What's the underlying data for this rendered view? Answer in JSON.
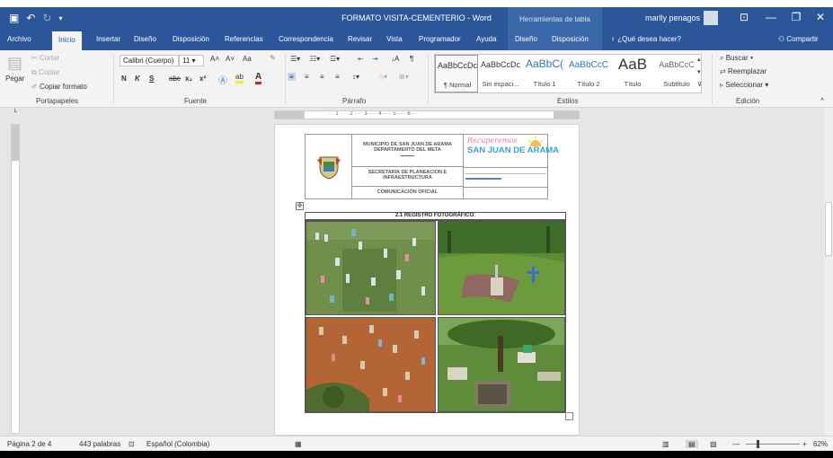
{
  "window": {
    "title": "FORMATO VISITA-CEMENTERIO  -  Word",
    "contextual_tab_title": "Herramientas de tabla",
    "user_name": "marlly penagos",
    "accent_color": "#2b579a"
  },
  "tabs": [
    {
      "label": "Archivo"
    },
    {
      "label": "Inicio",
      "active": true
    },
    {
      "label": "Insertar"
    },
    {
      "label": "Diseño"
    },
    {
      "label": "Disposición"
    },
    {
      "label": "Referencias"
    },
    {
      "label": "Correspondencia"
    },
    {
      "label": "Revisar"
    },
    {
      "label": "Vista"
    },
    {
      "label": "Programador"
    },
    {
      "label": "Ayuda"
    },
    {
      "label": "Diseño"
    },
    {
      "label": "Disposición"
    }
  ],
  "tell_me": "¿Qué desea hacer?",
  "share": "Compartir",
  "clipboard": {
    "paste": "Pegar",
    "cut": "Cortar",
    "copy": "Copiar",
    "format_painter": "Copiar formato",
    "group_label": "Portapapeles"
  },
  "font": {
    "name": "Calibri (Cuerpo)",
    "size": "11",
    "group_label": "Fuente",
    "bold": "N",
    "italic": "K",
    "underline": "S",
    "strike": "abc",
    "subscript": "x₂",
    "superscript": "x²",
    "grow": "A˄",
    "shrink": "A˅",
    "case": "Aa"
  },
  "paragraph": {
    "group_label": "Párrafo"
  },
  "styles": {
    "group_label": "Estilos",
    "items": [
      {
        "preview": "AaBbCcDc",
        "name": "¶ Normal"
      },
      {
        "preview": "AaBbCcDc",
        "name": "Sin espaci..."
      },
      {
        "preview": "AaBbC(",
        "name": "Título 1"
      },
      {
        "preview": "AaBbCcC",
        "name": "Título 2"
      },
      {
        "preview": "AaB",
        "name": "Título"
      },
      {
        "preview": "AaBbCcC",
        "name": "Subtítulo"
      }
    ]
  },
  "editing": {
    "group_label": "Edición",
    "find": "Buscar",
    "replace": "Reemplazar",
    "select": "Seleccionar"
  },
  "document": {
    "header_left_lines": [
      "MUNICIPIO DE SAN JUAN DE ARAMA",
      "DEPARTAMENTO DEL META"
    ],
    "header_secretaria": "SECRETARIA DE PLANEACION E INFRAESTRUCTURA",
    "header_comunicacion": "COMUNICACIÓN OFICIAL",
    "logo_script": "Recuperemos",
    "logo_main": "SAN JUAN DE ARAMA",
    "section_title": "2.1      REGISTRO FOTOGRÁFICO:"
  },
  "status": {
    "page": "Página 2 de 4",
    "words": "443 palabras",
    "language": "Español (Colombia)",
    "zoom": "62%"
  }
}
